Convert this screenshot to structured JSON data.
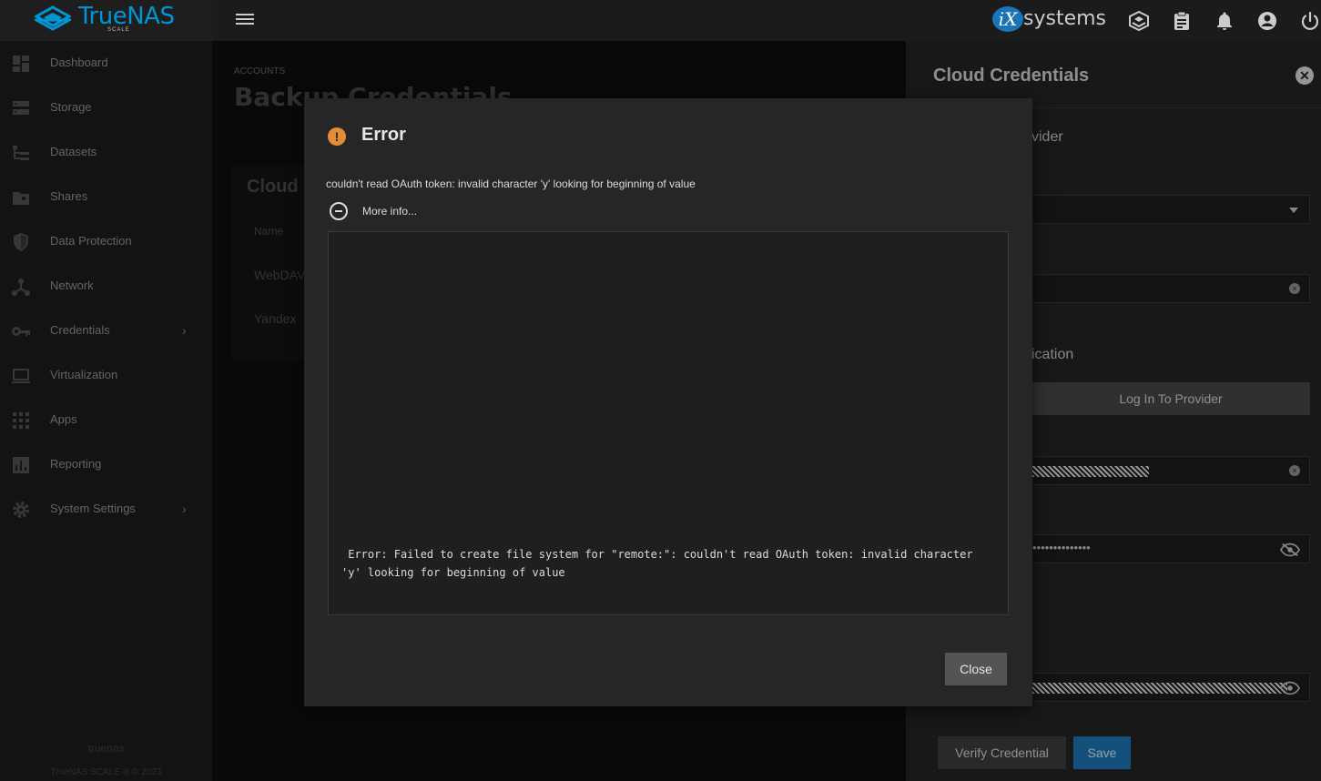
{
  "topbar": {
    "brand_name": "TrueNAS",
    "brand_sub": "SCALE",
    "vendor_logo_ix": "iX",
    "vendor_logo_text": "systems",
    "icons": [
      "truecommand-icon",
      "clipboard-icon",
      "bell-icon",
      "account-icon",
      "power-icon"
    ]
  },
  "sidebar": {
    "items": [
      {
        "label": "Dashboard",
        "icon": "dashboard-icon"
      },
      {
        "label": "Storage",
        "icon": "storage-icon"
      },
      {
        "label": "Datasets",
        "icon": "datasets-icon"
      },
      {
        "label": "Shares",
        "icon": "shares-icon"
      },
      {
        "label": "Data Protection",
        "icon": "shield-icon"
      },
      {
        "label": "Network",
        "icon": "network-icon"
      },
      {
        "label": "Credentials",
        "icon": "key-icon",
        "chevron": "›"
      },
      {
        "label": "Virtualization",
        "icon": "laptop-icon"
      },
      {
        "label": "Apps",
        "icon": "apps-grid-icon"
      },
      {
        "label": "Reporting",
        "icon": "chart-icon"
      },
      {
        "label": "System Settings",
        "icon": "gear-icon",
        "chevron": "›"
      }
    ],
    "footer_host": "truenas",
    "footer_copyright": "TrueNAS SCALE ® © 2023"
  },
  "main": {
    "breadcrumb": "ACCOUNTS",
    "title": "Backup Credentials",
    "card_title": "Cloud C",
    "column_name": "Name",
    "rows": [
      "WebDAV",
      "Yandex"
    ]
  },
  "panel": {
    "title": "Cloud Credentials",
    "section_provider": "vider",
    "section_auth": "ication",
    "login_button": "Log In To Provider",
    "password_dots": "••••••••••••••",
    "verify_button": "Verify Credential",
    "save_button": "Save"
  },
  "modal": {
    "title": "Error",
    "message": "couldn't read OAuth token: invalid character 'y' looking for beginning of value",
    "more_info": "More info...",
    "trace": " Error: Failed to create file system for \"remote:\": couldn't read OAuth token: invalid character 'y' looking for beginning of value",
    "close_button": "Close"
  },
  "colors": {
    "accent": "#0095d5",
    "save": "#1f7bbf",
    "warning": "#e38c35"
  }
}
